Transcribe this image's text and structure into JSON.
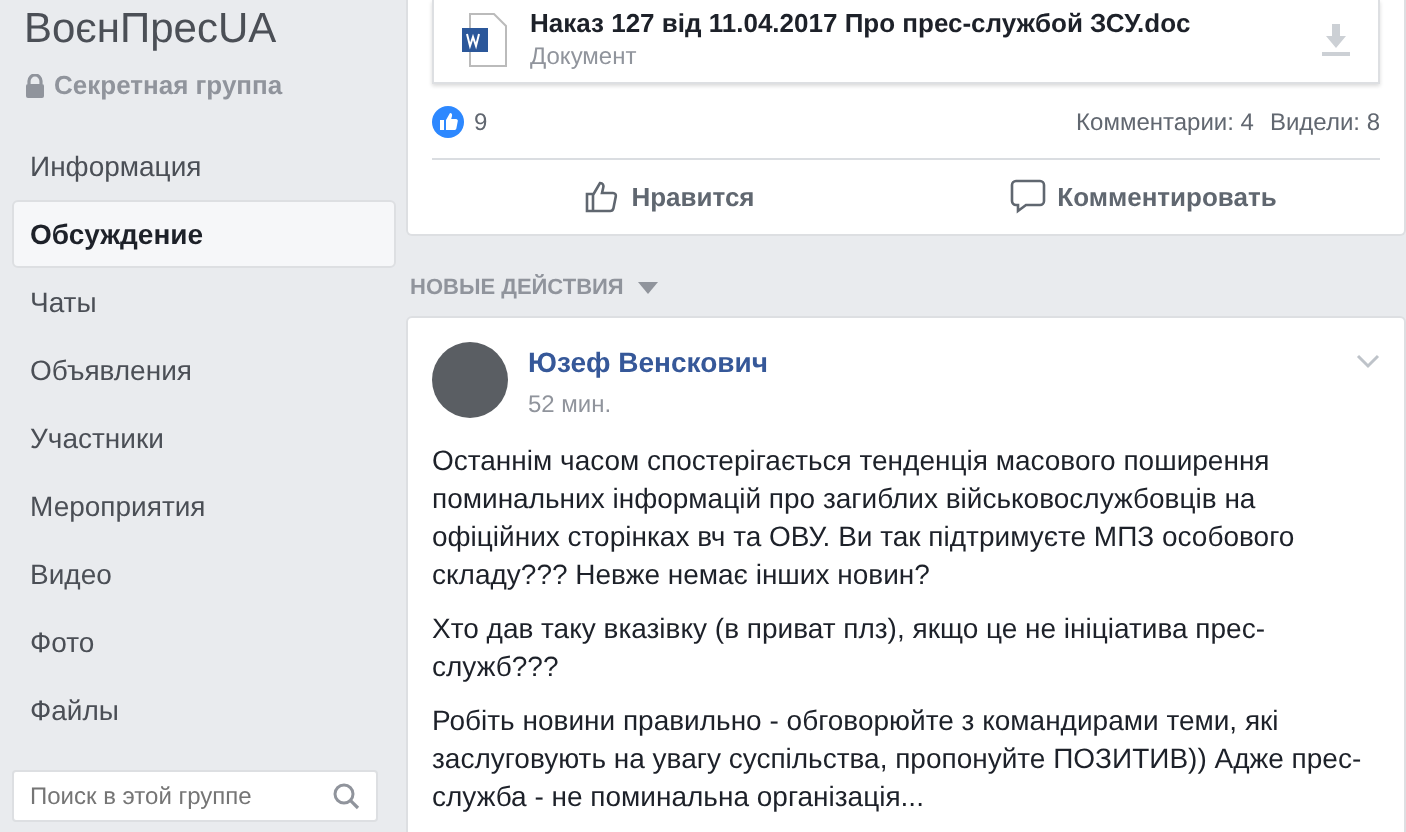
{
  "group": {
    "name": "ВоєнПресUA",
    "privacy": "Секретная группа"
  },
  "nav": [
    {
      "label": "Информация",
      "selected": false
    },
    {
      "label": "Обсуждение",
      "selected": true
    },
    {
      "label": "Чаты",
      "selected": false
    },
    {
      "label": "Объявления",
      "selected": false
    },
    {
      "label": "Участники",
      "selected": false
    },
    {
      "label": "Мероприятия",
      "selected": false
    },
    {
      "label": "Видео",
      "selected": false
    },
    {
      "label": "Фото",
      "selected": false
    },
    {
      "label": "Файлы",
      "selected": false
    }
  ],
  "search": {
    "placeholder": "Поиск в этой группе"
  },
  "top_post": {
    "attachment": {
      "title": "Наказ 127 від 11.04.2017 Про прес-службой ЗСУ.doc",
      "type": "Документ"
    },
    "likes": "9",
    "comments": "Комментарии: 4",
    "seen": "Видели: 8",
    "actions": [
      {
        "kind": "like",
        "label": "Нравится"
      },
      {
        "kind": "comment",
        "label": "Комментировать"
      }
    ]
  },
  "section_title": "НОВЫЕ ДЕЙСТВИЯ",
  "post": {
    "author": "Юзеф Венскович",
    "time": "52 мин.",
    "paragraphs": [
      "Останнім часом спостерігається тенденція масового поширення поминальних інформацій про загиблих військовослужбовців на офіційних сторінках вч та ОВУ. Ви так підтримуєте МПЗ особового складу??? Невже немає інших новин?",
      "Хто дав таку вказівку (в приват плз), якщо це не ініціатива прес-служб???",
      "Робіть новини правильно - обговорюйте з командирами теми, які заслуговують на увагу суспільства, пропонуйте ПОЗИТИВ)) Адже прес-служба - не поминальна організація..."
    ]
  }
}
